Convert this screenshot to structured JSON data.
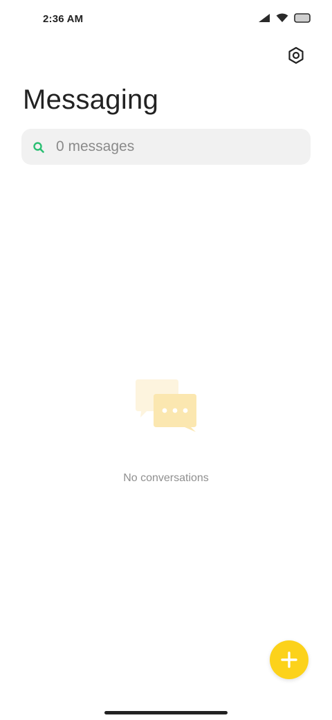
{
  "status_bar": {
    "time": "2:36 AM",
    "icons": [
      "signal-icon",
      "wifi-icon",
      "battery-icon"
    ]
  },
  "header": {
    "title": "Messaging",
    "settings_icon": "settings-icon"
  },
  "search": {
    "placeholder": "0 messages",
    "icon": "search-icon"
  },
  "empty_state": {
    "icon": "conversations-icon",
    "text": "No conversations"
  },
  "fab": {
    "icon": "plus-icon"
  },
  "colors": {
    "accent": "#fcd21b",
    "search_icon": "#2bbf73",
    "search_background": "#f1f1f1",
    "illustration": "#fbe7b0"
  }
}
